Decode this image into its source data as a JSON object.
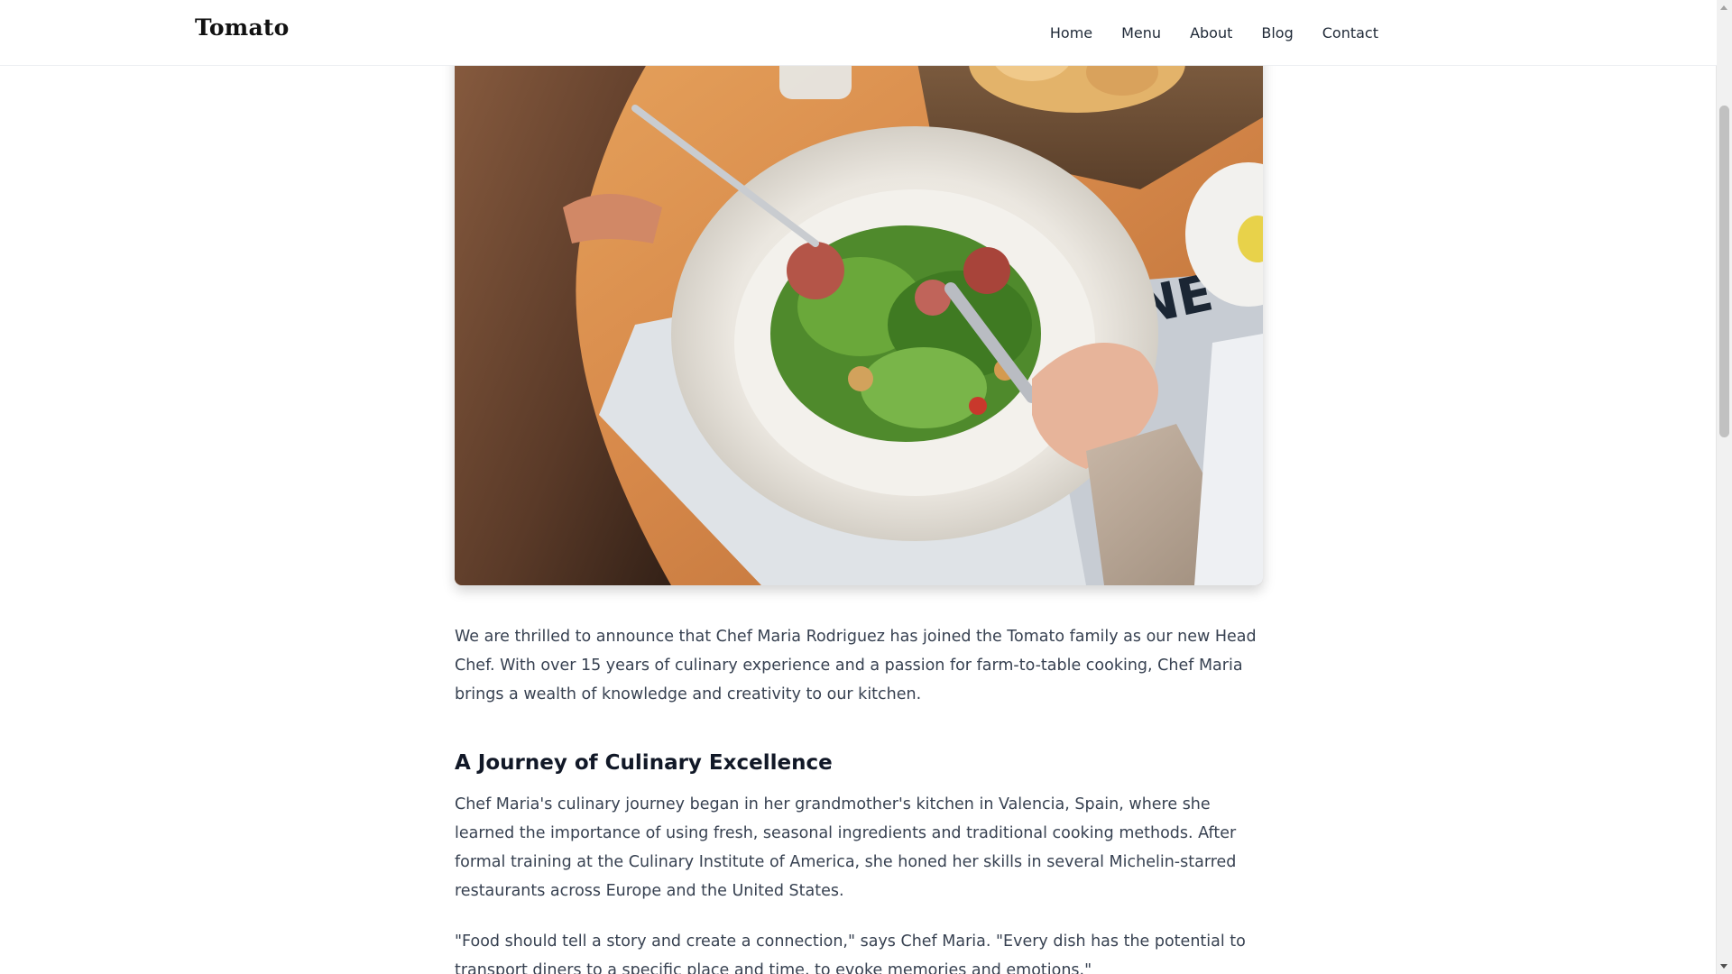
{
  "header": {
    "logo": "Tomato",
    "nav": [
      "Home",
      "Menu",
      "About",
      "Blog",
      "Contact"
    ]
  },
  "hero": {
    "icon": "salad-photo"
  },
  "article": {
    "intro": "We are thrilled to announce that Chef Maria Rodriguez has joined the Tomato family as our new Head Chef. With over 15 years of culinary experience and a passion for farm-to-table cooking, Chef Maria brings a wealth of knowledge and creativity to our kitchen.",
    "heading": "A Journey of Culinary Excellence",
    "journey": "Chef Maria's culinary journey began in her grandmother's kitchen in Valencia, Spain, where she learned the importance of using fresh, seasonal ingredients and traditional cooking methods. After formal training at the Culinary Institute of America, she honed her skills in several Michelin-starred restaurants across Europe and the United States.",
    "quote": "\"Food should tell a story and create a connection,\" says Chef Maria. \"Every dish has the potential to transport diners to a specific place and time, to evoke memories and emotions.\""
  },
  "colors": {
    "text": "#374151",
    "heading": "#111827",
    "nav": "#1f2937"
  }
}
